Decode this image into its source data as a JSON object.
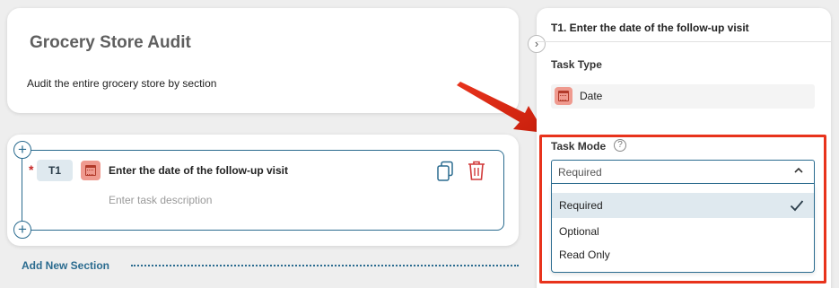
{
  "audit": {
    "title": "Grocery Store Audit",
    "description": "Audit the entire grocery store by section"
  },
  "task": {
    "required_mark": "*",
    "tag": "T1",
    "title": "Enter the date of the follow-up visit",
    "description_placeholder": "Enter task description",
    "type_icon": "calendar-icon"
  },
  "add_section_label": "Add New Section",
  "panel": {
    "title": "T1. Enter the date of the follow-up visit",
    "task_type_label": "Task Type",
    "task_type_value": "Date",
    "task_mode_label": "Task Mode",
    "help_glyph": "?",
    "task_mode_selected": "Required",
    "task_mode_options": [
      "Required",
      "Optional",
      "Read Only"
    ]
  },
  "colors": {
    "accent": "#2a6b8f",
    "highlight": "#e8331c",
    "date_badge": "#ef9a8f",
    "required_star": "#c62828"
  }
}
